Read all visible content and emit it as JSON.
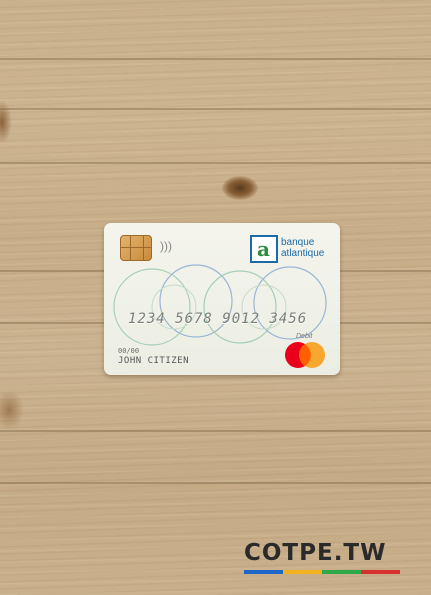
{
  "card": {
    "bank_line1": "banque",
    "bank_line2": "atlantique",
    "number": "1234 5678 9012 3456",
    "type_label": "Debit",
    "expiry": "00/00",
    "holder": "JOHN CITIZEN",
    "network": "mastercard"
  },
  "watermark": {
    "text": "COTPE.TW",
    "bar_colors": [
      "#1e66c8",
      "#f2b21c",
      "#2fa84a",
      "#d8322f"
    ]
  },
  "colors": {
    "bank_blue": "#1c6aa8",
    "mc_red": "#eb001b",
    "mc_yellow": "#f79e1b"
  }
}
